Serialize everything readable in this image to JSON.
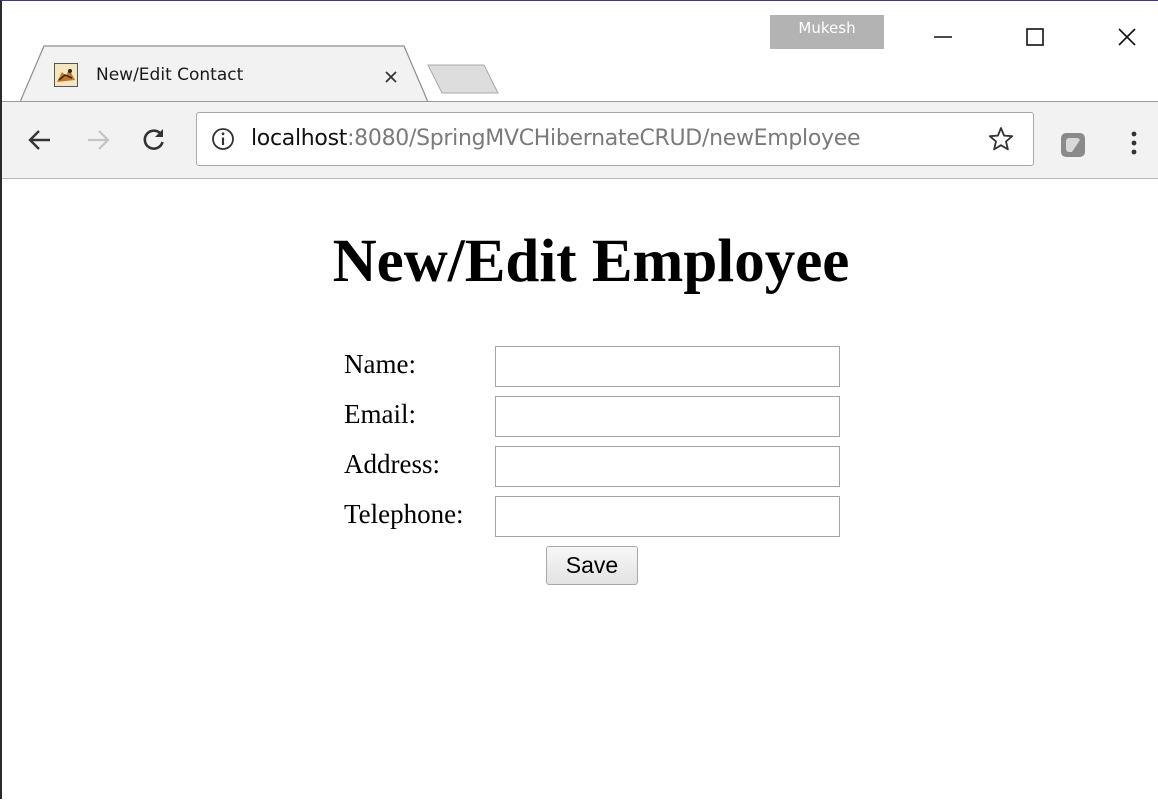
{
  "browser": {
    "profile_name": "Mukesh",
    "tab": {
      "title": "New/Edit Contact"
    },
    "address_bar": {
      "url_host": "localhost",
      "url_rest": ":8080/SpringMVCHibernateCRUD/newEmployee"
    }
  },
  "page": {
    "heading": "New/Edit Employee",
    "form": {
      "fields": [
        {
          "label": "Name:",
          "value": ""
        },
        {
          "label": "Email:",
          "value": ""
        },
        {
          "label": "Address:",
          "value": ""
        },
        {
          "label": "Telephone:",
          "value": ""
        }
      ],
      "submit_label": "Save"
    }
  },
  "icons": {
    "favicon": "tomcat-favicon-icon",
    "tab_close": "close-icon",
    "back": "arrow-left-icon",
    "forward": "arrow-right-icon",
    "reload": "reload-icon",
    "site_info": "info-icon",
    "bookmark": "star-icon",
    "extension": "extension-icon",
    "menu": "more-vertical-icon"
  },
  "colors": {
    "toolbar_bg": "#f2f2f2",
    "profile_badge_bg": "#b3b3b3",
    "url_host": "#111111",
    "url_rest": "#7a7a7a"
  }
}
